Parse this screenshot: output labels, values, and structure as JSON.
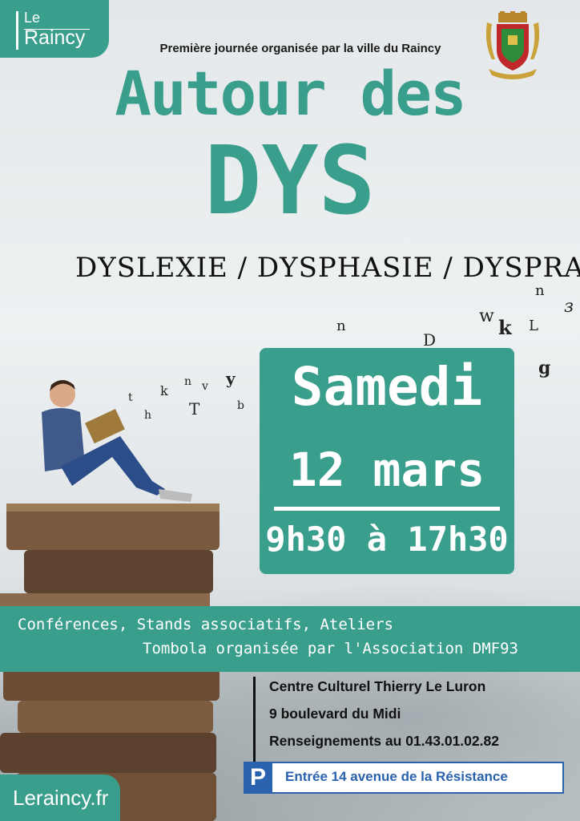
{
  "logo": {
    "le": "Le",
    "raincy": "Raincy"
  },
  "subtitle": "Première journée organisée par la ville du Raincy",
  "crest_icon": "coat-of-arms-icon",
  "title": {
    "line1": "Autour des",
    "line2": "DYS"
  },
  "dys_line": "DYSLEXIE / DYSPHASIE / DYSPRAXIE",
  "date": {
    "day": "Samedi",
    "date": "12 mars",
    "hours": "9h30 à 17h30"
  },
  "band": {
    "line1": "Conférences, Stands associatifs, Ateliers",
    "line2": "Tombola organisée par l'Association DMF93"
  },
  "venue": {
    "name": "Centre Culturel Thierry Le Luron",
    "address": "9 boulevard du Midi",
    "phone": "Renseignements au 01.43.01.02.82"
  },
  "parking": {
    "icon": "P",
    "text": "Entrée 14 avenue de la Résistance"
  },
  "website": "Leraincy.fr",
  "colors": {
    "teal": "#3a9e8c",
    "parking_blue": "#2a62b0"
  }
}
